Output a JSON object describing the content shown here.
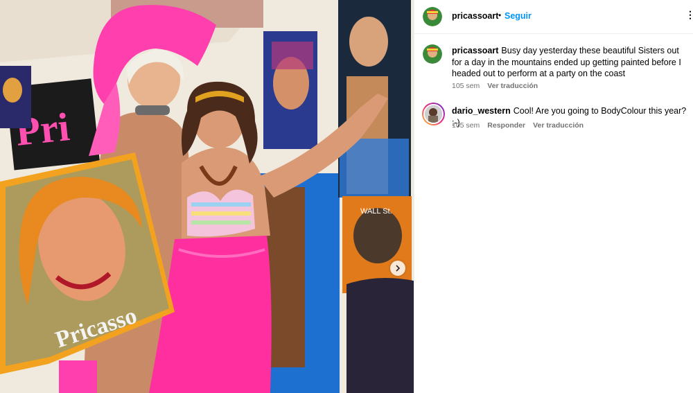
{
  "post": {
    "author": "pricassoart",
    "follow_label": "Seguir",
    "separator": "•",
    "more_menu": "⋮",
    "photo_signature": "Pricasso",
    "photo_sign_partial": "Pri",
    "photo_sign_tag": "WALL St."
  },
  "comments": [
    {
      "user": "pricassoart",
      "text": "Busy day yesterday these beautiful Sisters out for a day in the mountains ended up getting painted before I headed out to perform at a party on the coast",
      "time": "105 sem",
      "translate": "Ver traducción"
    },
    {
      "user": "dario_western",
      "text": "Cool! Are you going to BodyColour this year? :-)",
      "time": "105 sem",
      "reply": "Responder",
      "translate": "Ver traducción"
    }
  ],
  "colors": {
    "accent": "#0095f6",
    "muted": "#737373",
    "pink": "#ff2fa0"
  }
}
